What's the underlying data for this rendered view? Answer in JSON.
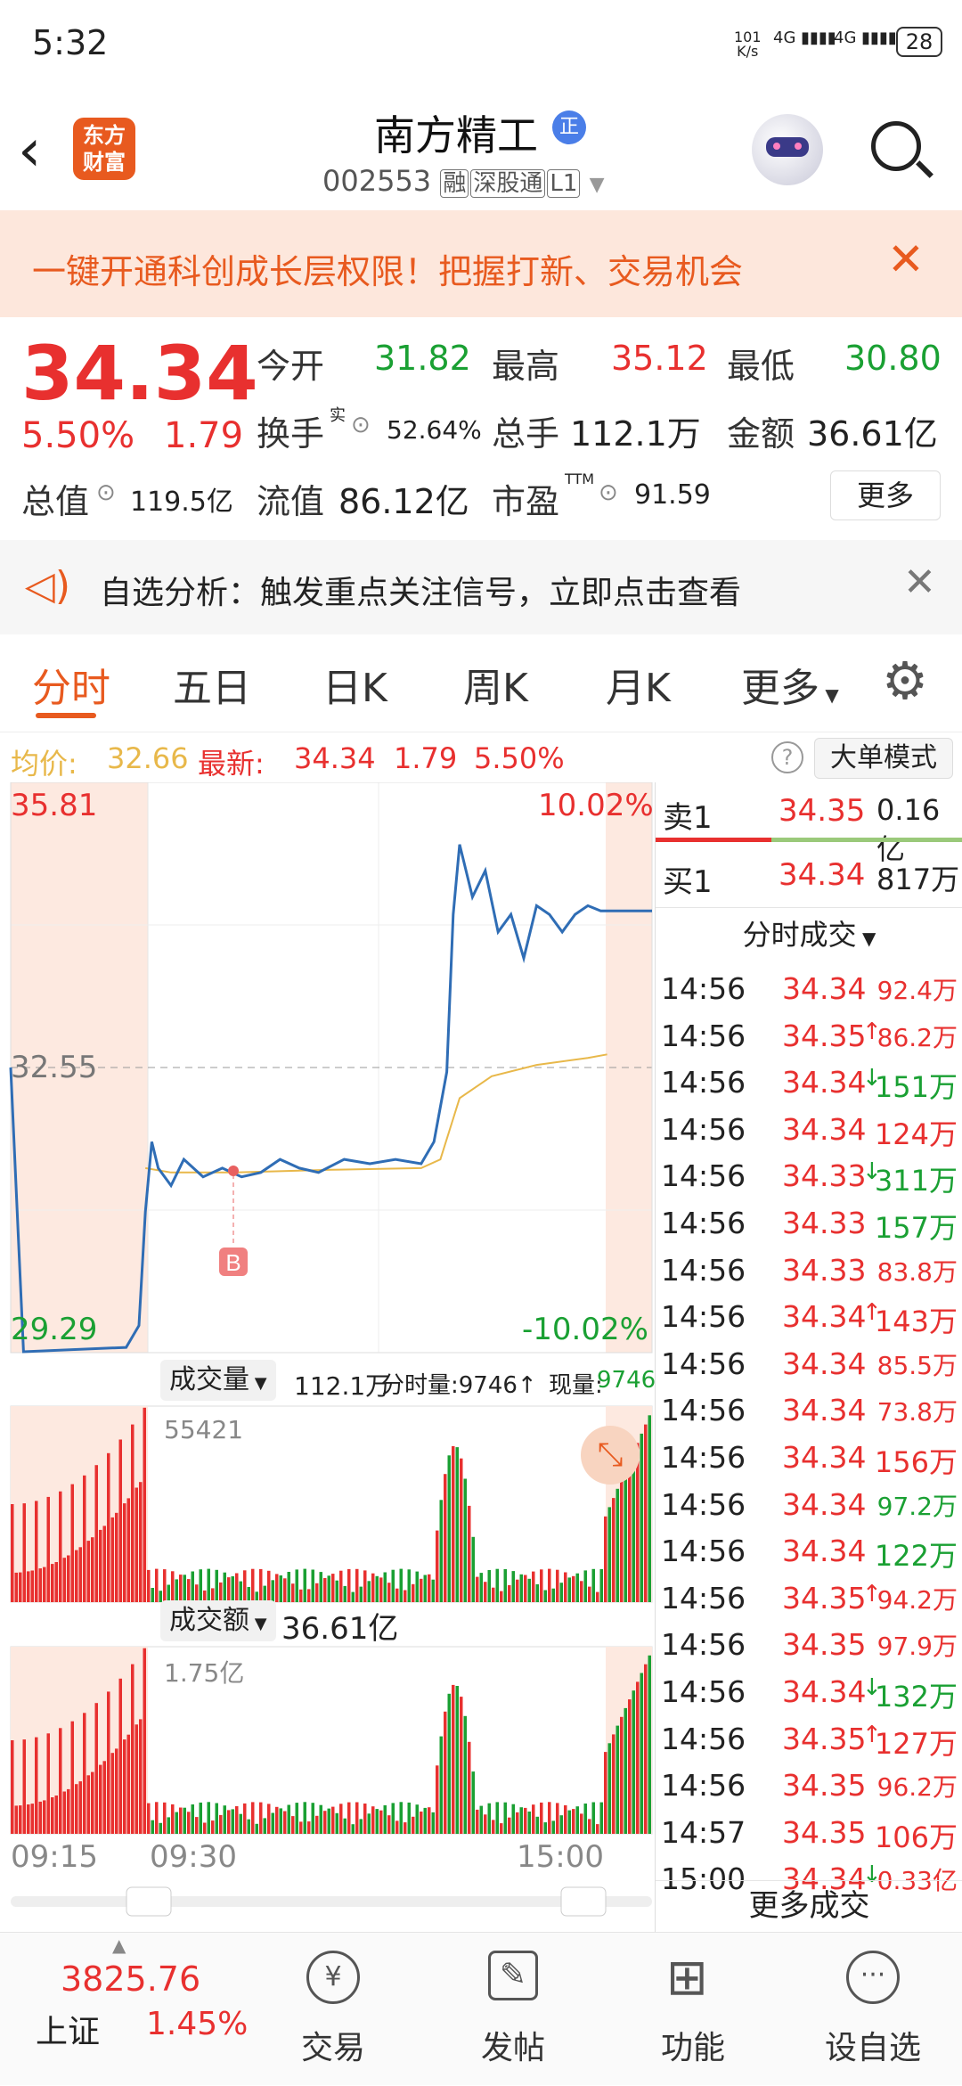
{
  "status_bar": {
    "time": "5:32",
    "net_speed_top": "101",
    "net_speed_bottom": "K/s",
    "net1": "4G",
    "net2": "4G",
    "battery": "28"
  },
  "header": {
    "stock_name": "南方精工",
    "badge": "正",
    "code": "002553",
    "tags": [
      "融",
      "深股通",
      "L1"
    ],
    "app_logo_line1": "东方",
    "app_logo_line2": "财富"
  },
  "banner": {
    "text": "一键开通科创成长层权限！把握打新、交易机会"
  },
  "quote": {
    "price": "34.34",
    "change_pct": "5.50%",
    "change": "1.79",
    "open_label": "今开",
    "open": "31.82",
    "high_label": "最高",
    "high": "35.12",
    "low_label": "最低",
    "low": "30.80",
    "turnover_label": "换手",
    "turnover_sup": "实",
    "turnover": "52.64%",
    "volume_label": "总手",
    "volume": "112.1万",
    "amount_label": "金额",
    "amount": "36.61亿",
    "mktcap_label": "总值",
    "mktcap": "119.5亿",
    "float_label": "流值",
    "float_cap": "86.12亿",
    "pe_label": "市盈",
    "pe_sup": "TTM",
    "pe": "91.59",
    "more_button": "更多"
  },
  "alert": {
    "text": "自选分析：触发重点关注信号，立即点击查看"
  },
  "tabs": [
    "分时",
    "五日",
    "日K",
    "周K",
    "月K",
    "更多"
  ],
  "avg_bar": {
    "avg_label": "均价:",
    "avg": "32.66",
    "last_label": "最新:",
    "last": "34.34",
    "chg": "1.79",
    "pct": "5.50%",
    "mode_button": "大单模式"
  },
  "chart": {
    "y_max": "35.81",
    "y_mid": "32.55",
    "y_min": "29.29",
    "pct_max": "10.02%",
    "pct_min": "-10.02%",
    "marker": "B",
    "vol_label": "成交量",
    "vol_total": "112.1万",
    "vol_min_label": "分时量:9746↑",
    "vol_now_label": "现量:",
    "vol_now": "9746",
    "vol_max": "55421",
    "amt_label": "成交额",
    "amt_total": "36.61亿",
    "amt_max": "1.75亿",
    "time_start": "09:15",
    "time_open": "09:30",
    "time_end": "15:00"
  },
  "chart_data": {
    "type": "line",
    "x_range": [
      "09:15",
      "15:00"
    ],
    "ylim": [
      29.29,
      35.81
    ],
    "prev_close": 32.55,
    "series": [
      {
        "name": "最新",
        "color": "#2f6db5",
        "points": [
          [
            0,
            32.55
          ],
          [
            0.02,
            29.3
          ],
          [
            0.18,
            29.35
          ],
          [
            0.2,
            29.6
          ],
          [
            0.21,
            30.9
          ],
          [
            0.22,
            31.7
          ],
          [
            0.23,
            31.4
          ],
          [
            0.25,
            31.2
          ],
          [
            0.27,
            31.5
          ],
          [
            0.3,
            31.3
          ],
          [
            0.33,
            31.4
          ],
          [
            0.36,
            31.3
          ],
          [
            0.39,
            31.35
          ],
          [
            0.42,
            31.5
          ],
          [
            0.45,
            31.4
          ],
          [
            0.48,
            31.35
          ],
          [
            0.52,
            31.5
          ],
          [
            0.56,
            31.45
          ],
          [
            0.6,
            31.5
          ],
          [
            0.64,
            31.45
          ],
          [
            0.66,
            31.7
          ],
          [
            0.68,
            32.5
          ],
          [
            0.69,
            34.3
          ],
          [
            0.7,
            35.1
          ],
          [
            0.72,
            34.5
          ],
          [
            0.74,
            34.8
          ],
          [
            0.76,
            34.1
          ],
          [
            0.78,
            34.3
          ],
          [
            0.8,
            33.8
          ],
          [
            0.82,
            34.4
          ],
          [
            0.84,
            34.3
          ],
          [
            0.86,
            34.1
          ],
          [
            0.88,
            34.3
          ],
          [
            0.9,
            34.4
          ],
          [
            0.92,
            34.34
          ],
          [
            1.0,
            34.34
          ]
        ]
      },
      {
        "name": "均价",
        "color": "#e8b84a",
        "points": [
          [
            0.21,
            31.4
          ],
          [
            0.25,
            31.35
          ],
          [
            0.35,
            31.35
          ],
          [
            0.5,
            31.38
          ],
          [
            0.64,
            31.4
          ],
          [
            0.67,
            31.5
          ],
          [
            0.7,
            32.2
          ],
          [
            0.75,
            32.45
          ],
          [
            0.82,
            32.58
          ],
          [
            0.9,
            32.66
          ],
          [
            0.93,
            32.7
          ]
        ]
      }
    ]
  },
  "trades": {
    "sell1_label": "卖1",
    "sell1_price": "34.35",
    "sell1_vol": "0.16亿",
    "buy1_label": "买1",
    "buy1_price": "34.34",
    "buy1_vol": "817万",
    "list_title": "分时成交",
    "rows": [
      {
        "t": "14:56",
        "p": "34.34",
        "a": "",
        "v": "92.4万",
        "vc": "red"
      },
      {
        "t": "14:56",
        "p": "34.35",
        "a": "↑",
        "v": "86.2万",
        "vc": "red"
      },
      {
        "t": "14:56",
        "p": "34.34",
        "a": "↓",
        "v": "151万",
        "vc": "green"
      },
      {
        "t": "14:56",
        "p": "34.34",
        "a": "",
        "v": "124万",
        "vc": "red"
      },
      {
        "t": "14:56",
        "p": "34.33",
        "a": "↓",
        "v": "311万",
        "vc": "green"
      },
      {
        "t": "14:56",
        "p": "34.33",
        "a": "",
        "v": "157万",
        "vc": "green"
      },
      {
        "t": "14:56",
        "p": "34.33",
        "a": "",
        "v": "83.8万",
        "vc": "red"
      },
      {
        "t": "14:56",
        "p": "34.34",
        "a": "↑",
        "v": "143万",
        "vc": "red"
      },
      {
        "t": "14:56",
        "p": "34.34",
        "a": "",
        "v": "85.5万",
        "vc": "red"
      },
      {
        "t": "14:56",
        "p": "34.34",
        "a": "",
        "v": "73.8万",
        "vc": "red"
      },
      {
        "t": "14:56",
        "p": "34.34",
        "a": "",
        "v": "156万",
        "vc": "red"
      },
      {
        "t": "14:56",
        "p": "34.34",
        "a": "",
        "v": "97.2万",
        "vc": "green"
      },
      {
        "t": "14:56",
        "p": "34.34",
        "a": "",
        "v": "122万",
        "vc": "green"
      },
      {
        "t": "14:56",
        "p": "34.35",
        "a": "↑",
        "v": "94.2万",
        "vc": "red"
      },
      {
        "t": "14:56",
        "p": "34.35",
        "a": "",
        "v": "97.9万",
        "vc": "red"
      },
      {
        "t": "14:56",
        "p": "34.34",
        "a": "↓",
        "v": "132万",
        "vc": "green"
      },
      {
        "t": "14:56",
        "p": "34.35",
        "a": "↑",
        "v": "127万",
        "vc": "red"
      },
      {
        "t": "14:56",
        "p": "34.35",
        "a": "",
        "v": "96.2万",
        "vc": "red"
      },
      {
        "t": "14:57",
        "p": "34.35",
        "a": "",
        "v": "106万",
        "vc": "red"
      },
      {
        "t": "15:00",
        "p": "34.34",
        "a": "↓",
        "v": "0.33亿",
        "vc": "red"
      }
    ],
    "more": "更多成交"
  },
  "bottom": {
    "index_value": "3825.76",
    "index_name": "上证",
    "index_pct": "1.45%",
    "nav": [
      {
        "label": "交易",
        "icon": "trade-icon"
      },
      {
        "label": "发帖",
        "icon": "post-icon"
      },
      {
        "label": "功能",
        "icon": "functions-icon"
      },
      {
        "label": "设自选",
        "icon": "add-watchlist-icon"
      }
    ]
  },
  "colors": {
    "up": "#e8302f",
    "down": "#1aa033",
    "price_line": "#2f6db5",
    "avg_line": "#e8b84a",
    "accent": "#e85a1f"
  }
}
